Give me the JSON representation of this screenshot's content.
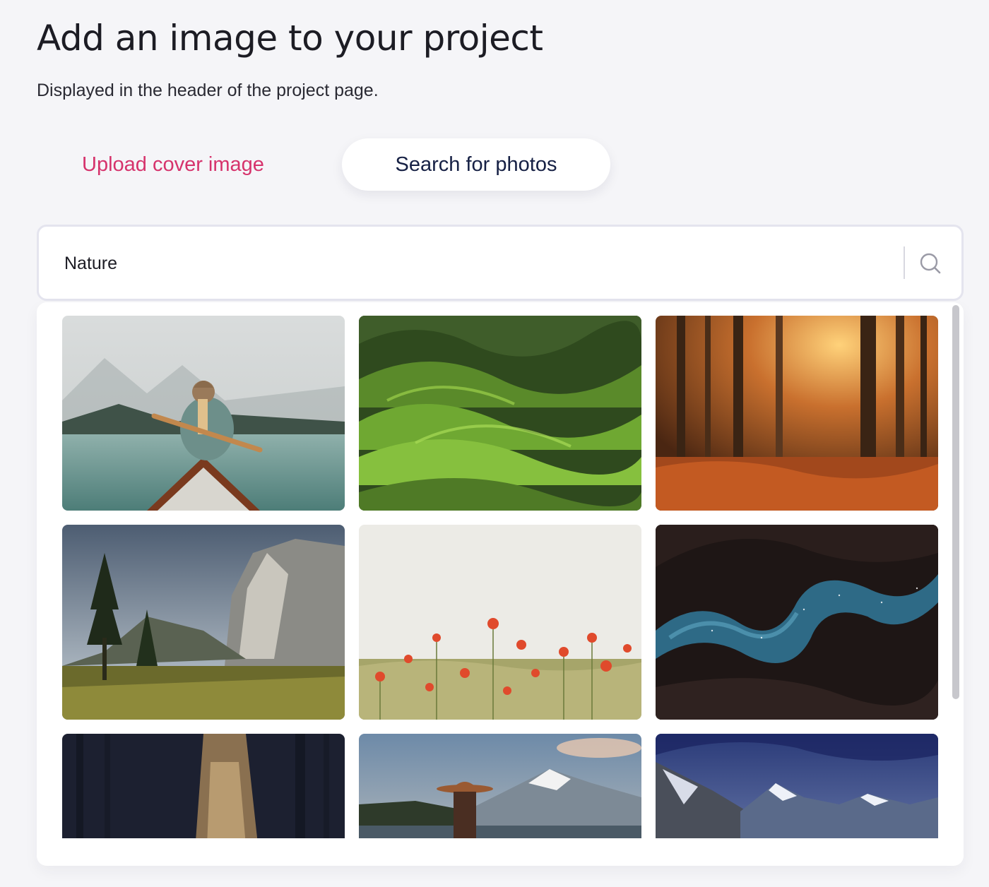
{
  "header": {
    "title": "Add an image to your project",
    "subtitle": "Displayed in the header of the project page."
  },
  "tabs": [
    {
      "label": "Upload cover image",
      "active": false
    },
    {
      "label": "Search for photos",
      "active": true
    }
  ],
  "search": {
    "value": "Nature",
    "icon": "search-icon"
  },
  "results": {
    "photos": [
      {
        "subject": "woman-in-canoe-on-misty-lake"
      },
      {
        "subject": "green-rolling-hills"
      },
      {
        "subject": "autumn-forest-sunrays"
      },
      {
        "subject": "granite-cliff-valley-trees"
      },
      {
        "subject": "red-poppy-field"
      },
      {
        "subject": "canyon-night-sky"
      },
      {
        "subject": "dark-forest-tree-trunk"
      },
      {
        "subject": "woman-with-hat-mountain-lake"
      },
      {
        "subject": "snowy-mountains-stormy-sky"
      }
    ]
  },
  "colors": {
    "accent": "#d6336c",
    "active_tab_text": "#162044",
    "background": "#f5f5f8"
  }
}
